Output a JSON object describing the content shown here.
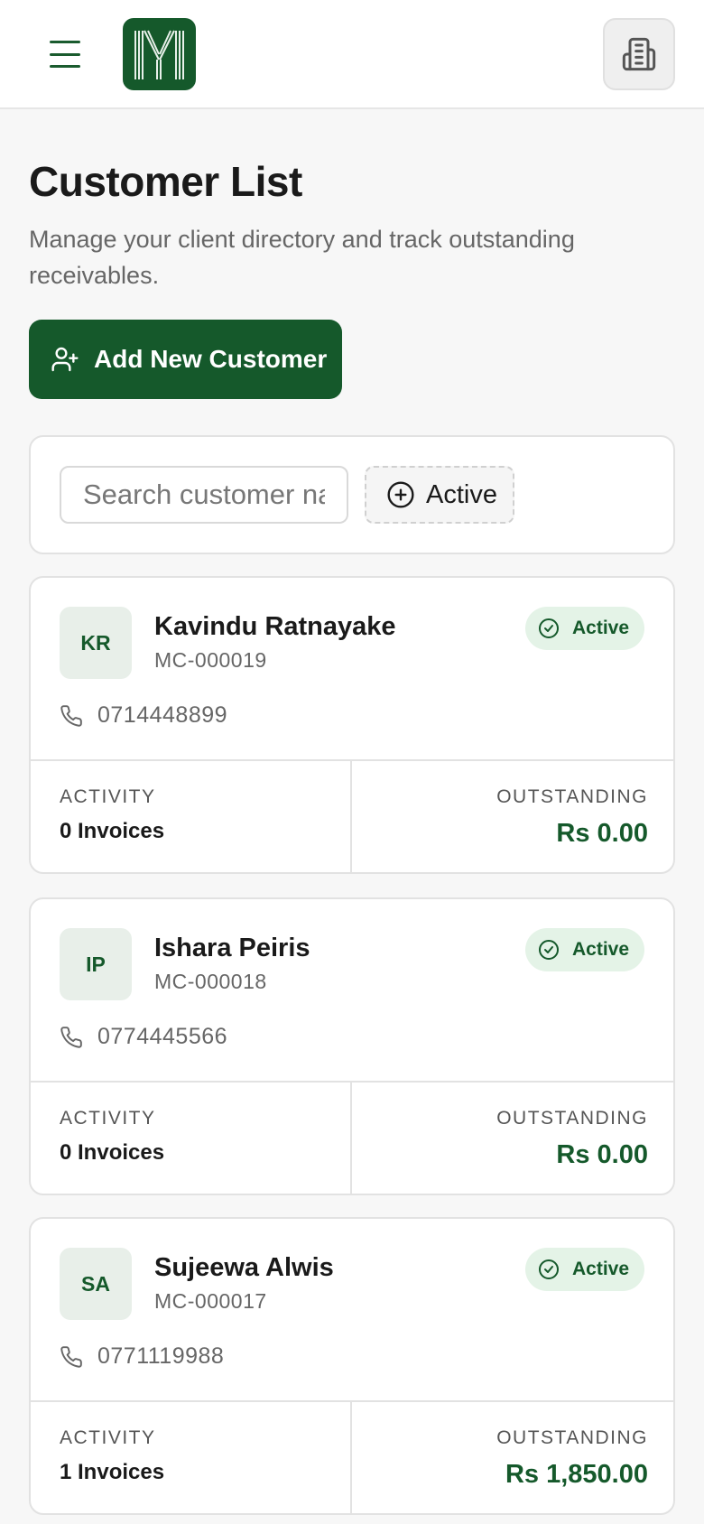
{
  "header": {
    "menu_icon": "hamburger-menu-icon",
    "logo_icon": "brand-logo",
    "org_icon": "building-icon"
  },
  "page": {
    "title": "Customer List",
    "subtitle": "Manage your client directory and track outstanding receivables."
  },
  "actions": {
    "add_customer_label": "Add New Customer",
    "add_customer_icon": "user-plus-icon"
  },
  "filters": {
    "search_placeholder": "Search customer name...",
    "status_filter_label": "Active",
    "status_filter_icon": "plus-circle-icon"
  },
  "labels": {
    "activity": "ACTIVITY",
    "outstanding": "OUTSTANDING"
  },
  "customers": [
    {
      "initials": "KR",
      "name": "Kavindu Ratnayake",
      "code": "MC-000019",
      "status": "Active",
      "phone": "0714448899",
      "invoices": "0 Invoices",
      "outstanding": "Rs 0.00"
    },
    {
      "initials": "IP",
      "name": "Ishara Peiris",
      "code": "MC-000018",
      "status": "Active",
      "phone": "0774445566",
      "invoices": "0 Invoices",
      "outstanding": "Rs 0.00"
    },
    {
      "initials": "SA",
      "name": "Sujeewa Alwis",
      "code": "MC-000017",
      "status": "Active",
      "phone": "0771119988",
      "invoices": "1 Invoices",
      "outstanding": "Rs 1,850.00"
    }
  ],
  "colors": {
    "brand_green": "#15592b",
    "badge_bg": "#e4f3e7",
    "page_bg": "#f7f7f7"
  }
}
